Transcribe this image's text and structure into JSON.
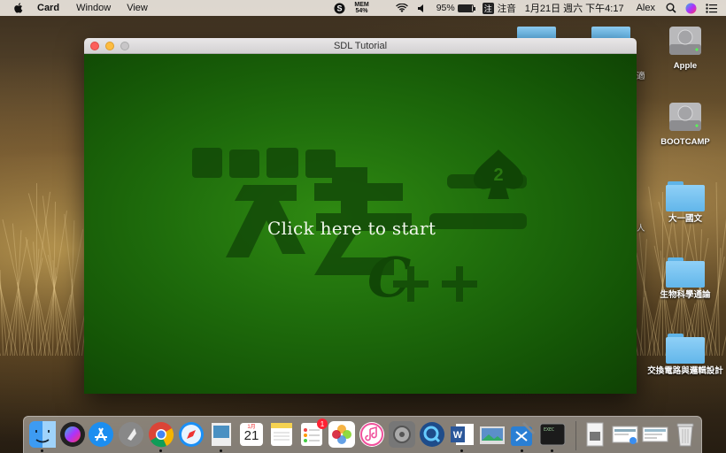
{
  "menubar": {
    "app_name": "Card",
    "items": [
      "Window",
      "View"
    ],
    "mem_label": "MEM",
    "mem_value": "54%",
    "battery": "95%",
    "battery_level": 0.95,
    "ime_icon": "注",
    "ime_label": "注音",
    "datetime": "1月21日 週六 下午4:17",
    "user": "Alex"
  },
  "window": {
    "title": "SDL Tutorial",
    "start_text": "Click here to start"
  },
  "desktop": {
    "icons": [
      {
        "label": "Apple",
        "type": "disk"
      },
      {
        "label": "BOOTCAMP",
        "type": "disk"
      },
      {
        "label": "大一國文",
        "type": "folder"
      },
      {
        "label": "生物科學通論",
        "type": "folder"
      },
      {
        "label": "交換電路與邏輯設計",
        "type": "folder"
      }
    ],
    "side_text_top": "適",
    "side_text_mid": "人"
  },
  "dock": {
    "calendar_month": "1月",
    "calendar_day": "21",
    "reminders_badge": "1",
    "terminal_text": "EXEC"
  },
  "colors": {
    "canvas_green": "#1f6d0c",
    "logo_dark": "#134a08",
    "folder_blue": "#62b6ea"
  }
}
